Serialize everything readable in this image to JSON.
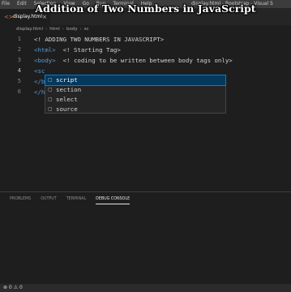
{
  "menu": [
    "File",
    "Edit",
    "Selection",
    "View",
    "Go",
    "Run",
    "Terminal",
    "Help"
  ],
  "window_title": "display.html - Bootstrap - Visual S",
  "overlay_title": "Addition of Two Numbers in JavaScript",
  "tab": {
    "label": "display.html",
    "close": "×",
    "icon": "<>"
  },
  "breadcrumb": [
    "display.html",
    "html",
    "body",
    "sc"
  ],
  "lines": [
    {
      "n": "1",
      "text": "<! ADDING TWO NUMBERS IN JAVASCRIPT>"
    },
    {
      "n": "2",
      "tag": "<html>",
      "text": "  <! Starting Tag>"
    },
    {
      "n": "3",
      "tag": "<body>",
      "text": "  <! coding to be written between body tags only>"
    },
    {
      "n": "4",
      "tag": "<sc"
    },
    {
      "n": "5",
      "tag": "</b"
    },
    {
      "n": "6",
      "tag": "</h"
    }
  ],
  "suggestions": [
    {
      "label": "script",
      "selected": true
    },
    {
      "label": "section",
      "selected": false
    },
    {
      "label": "select",
      "selected": false
    },
    {
      "label": "source",
      "selected": false
    }
  ],
  "panel_tabs": [
    "PROBLEMS",
    "OUTPUT",
    "TERMINAL",
    "DEBUG CONSOLE"
  ],
  "active_panel_tab": "DEBUG CONSOLE",
  "status": "⊗ 0  ⚠ 0",
  "colors": {
    "tag": "#569cd6",
    "selection": "#04395e",
    "selection_border": "#007fd4"
  }
}
